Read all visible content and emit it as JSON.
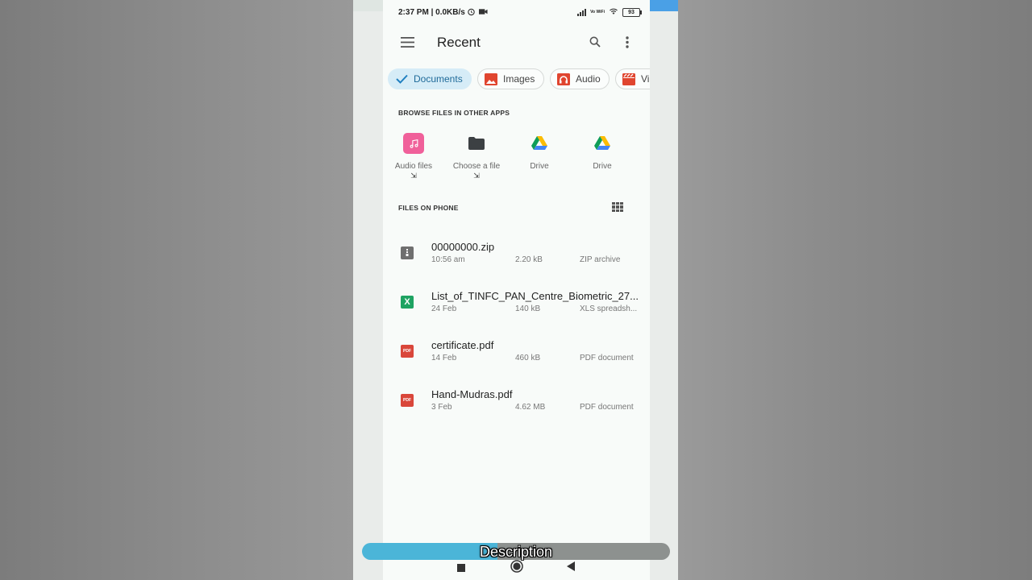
{
  "status_bar": {
    "time": "2:37 PM | 0.0KB/s",
    "volte": "Vo WiFi",
    "battery": "93"
  },
  "header": {
    "title": "Recent",
    "icons": [
      "menu-icon",
      "search-icon",
      "more-vert-icon"
    ]
  },
  "filter_chips": [
    {
      "label": "Documents",
      "icon": "check-icon",
      "selected": true
    },
    {
      "label": "Images",
      "icon": "image-icon",
      "color": "#e0452f"
    },
    {
      "label": "Audio",
      "icon": "headphones-icon",
      "color": "#e0452f"
    },
    {
      "label": "Vi",
      "icon": "video-icon",
      "color": "#e0452f"
    }
  ],
  "browse_section": {
    "title": "BROWSE FILES IN OTHER APPS",
    "apps": [
      {
        "label": "Audio files",
        "icon": "music-note-icon",
        "external": "⇲"
      },
      {
        "label": "Choose a file",
        "icon": "folder-icon",
        "external": "⇲"
      },
      {
        "label": "Drive",
        "icon": "google-drive-icon"
      },
      {
        "label": "Drive",
        "icon": "google-drive-icon"
      }
    ]
  },
  "files_section": {
    "title": "FILES ON PHONE",
    "files": [
      {
        "name": "00000000.zip",
        "date": "10:56 am",
        "size": "2.20 kB",
        "type": "ZIP archive",
        "icon": "zip-icon",
        "color": "#6f6f6f"
      },
      {
        "name": "List_of_TINFC_PAN_Centre_Biometric_27...",
        "date": "24 Feb",
        "size": "140 kB",
        "type": "XLS spreadsh...",
        "icon": "excel-icon",
        "color": "#1ea362"
      },
      {
        "name": "certificate.pdf",
        "date": "14 Feb",
        "size": "460 kB",
        "type": "PDF document",
        "icon": "pdf-icon",
        "color": "#d9463a"
      },
      {
        "name": "Hand-Mudras.pdf",
        "date": "3 Feb",
        "size": "4.62 MB",
        "type": "PDF document",
        "icon": "pdf-icon",
        "color": "#d9463a"
      }
    ]
  },
  "caption": {
    "text": "Description",
    "progress": 0.44
  }
}
